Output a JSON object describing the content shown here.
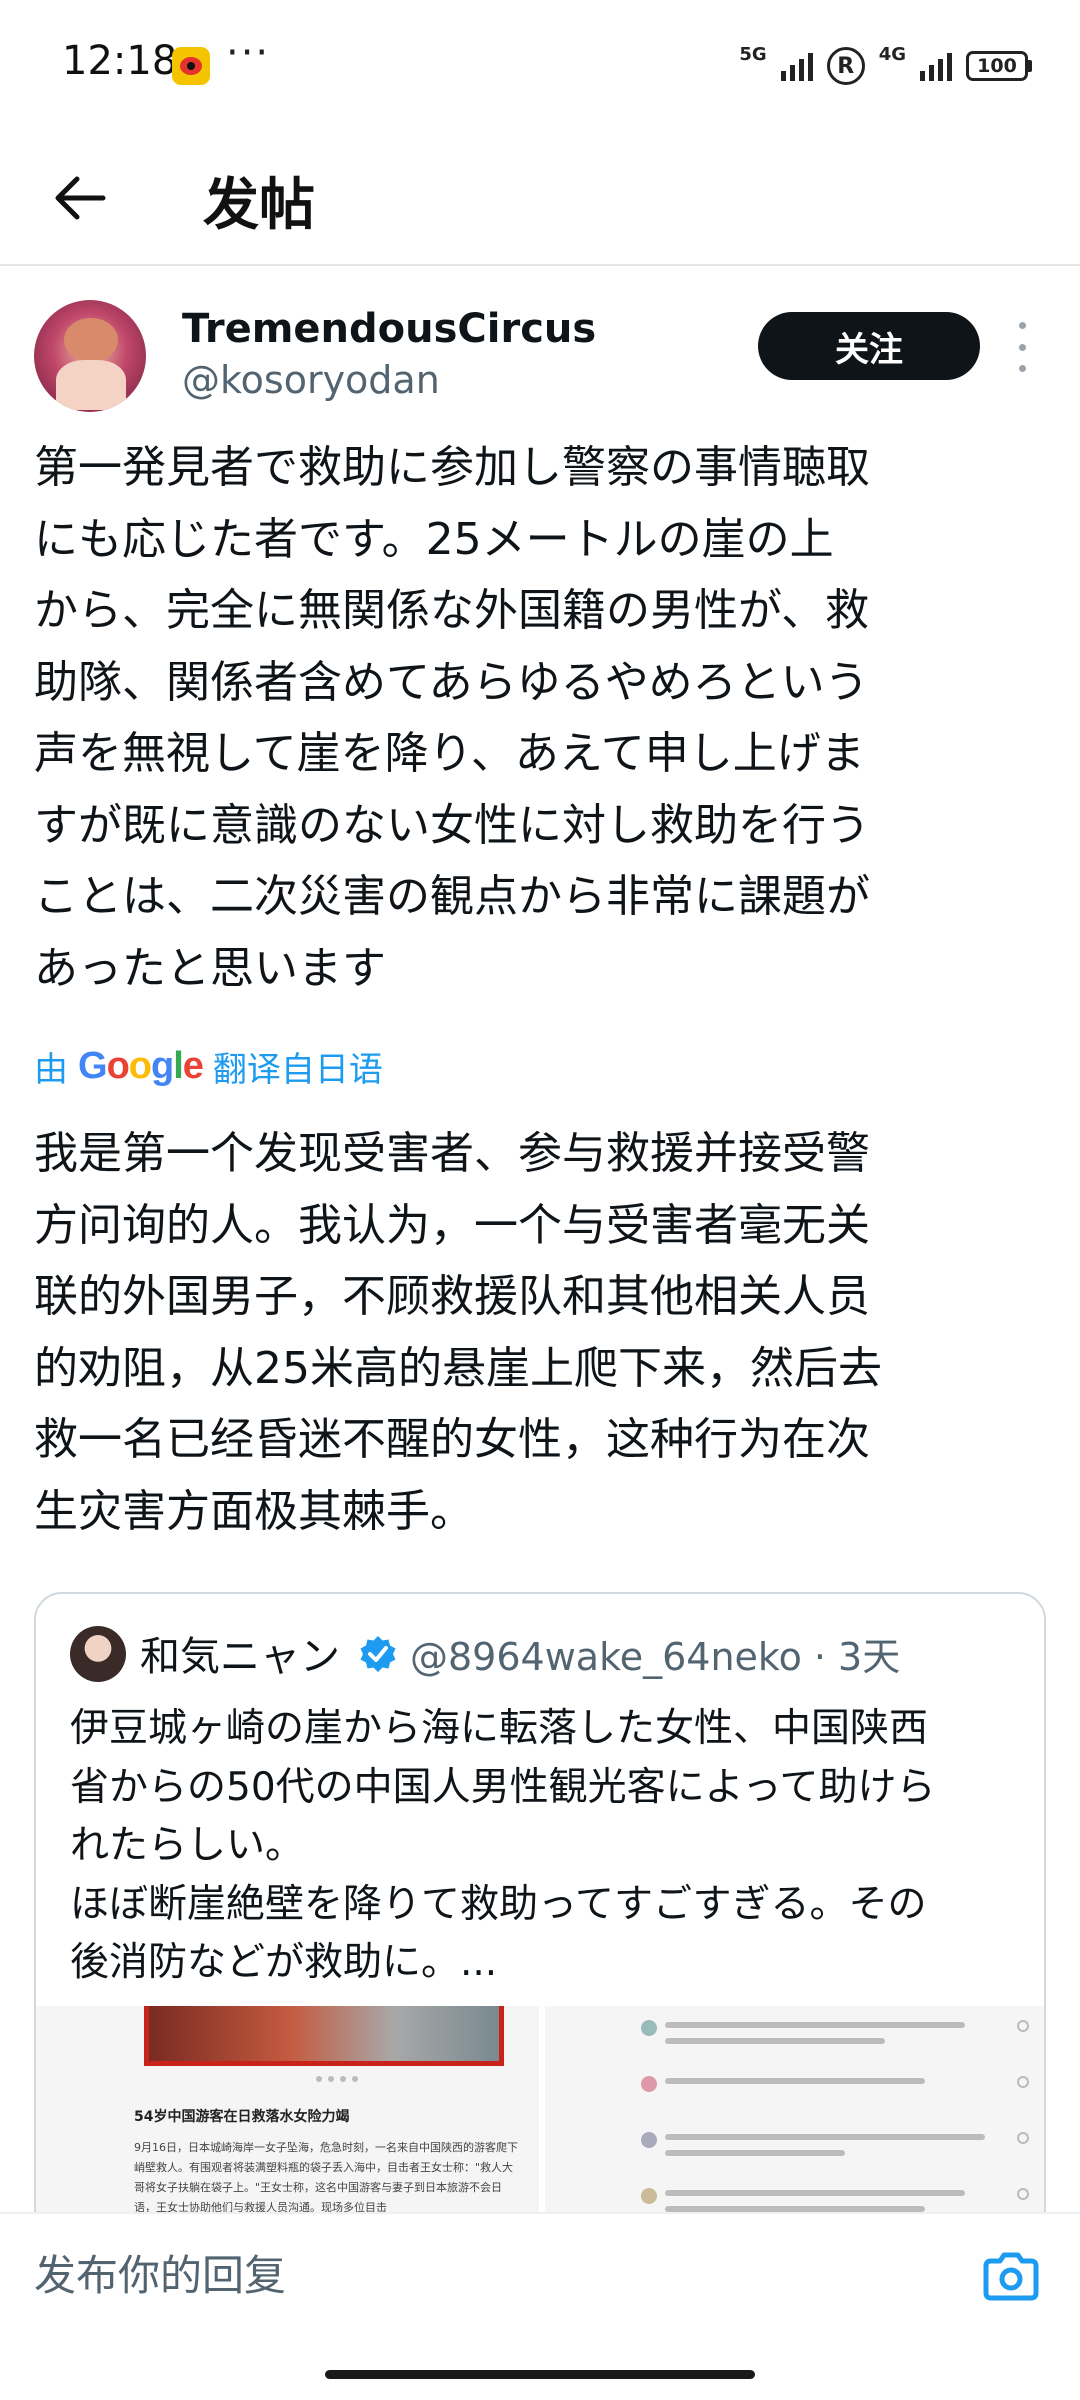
{
  "status_bar": {
    "time": "12:18",
    "dots": "···",
    "signal1_label": "5G",
    "signal2_label": "4G",
    "r_label": "R",
    "battery": "100"
  },
  "header": {
    "title": "发帖"
  },
  "post": {
    "author_name": "TremendousCircus",
    "author_handle": "@kosoryodan",
    "follow_label": "关注",
    "text": "第一発見者で救助に参加し警察の事情聴取\nにも応じた者です。25メートルの崖の上\nから、完全に無関係な外国籍の男性が、救\n助隊、関係者含めてあらゆるやめろという\n声を無視して崖を降り、あえて申し上げま\nすが既に意識のない女性に対し救助を行う\nことは、二次災害の観点から非常に課題が\nあったと思います",
    "translate_prefix": "由",
    "translate_brand": "Google",
    "translate_suffix": "翻译自日语",
    "translated_text": "我是第一个发现受害者、参与救援并接受警\n方问询的人。我认为，一个与受害者毫无关\n联的外国男子，不顾救援队和其他相关人员\n的劝阻，从25米高的悬崖上爬下来，然后去\n救一名已经昏迷不醒的女性，这种行为在次\n生灾害方面极其棘手。"
  },
  "quote": {
    "name": "和気ニャン",
    "handle_time": "@8964wake_64neko · 3天",
    "text": "伊豆城ヶ崎の崖から海に転落した女性、中国陕西\n省からの50代の中国人男性観光客によって助けら\nれたらしい。\nほぼ断崖絶壁を降りて救助ってすごすぎる。その\n後消防などが救助に。...",
    "image_left_title": "54岁中国游客在日救落水女险力竭",
    "image_left_body": "9月16日，日本城崎海岸一女子坠海，危急时刻，一名来自中国陕西的游客爬下峭壁救人。有围观者将装满塑料瓶的袋子丢入海中，目击者王女士称：\"救人大哥将女子扶躺在袋子上。\"王女士称，这名中国游客与妻子到日本旅游不会日语，王女士协助他们与救援人员沟通。现场多位目击"
  },
  "reply": {
    "placeholder": "发布你的回复"
  },
  "colors": {
    "accent": "#1d9bf0",
    "text": "#0f1419",
    "secondary": "#536471"
  }
}
